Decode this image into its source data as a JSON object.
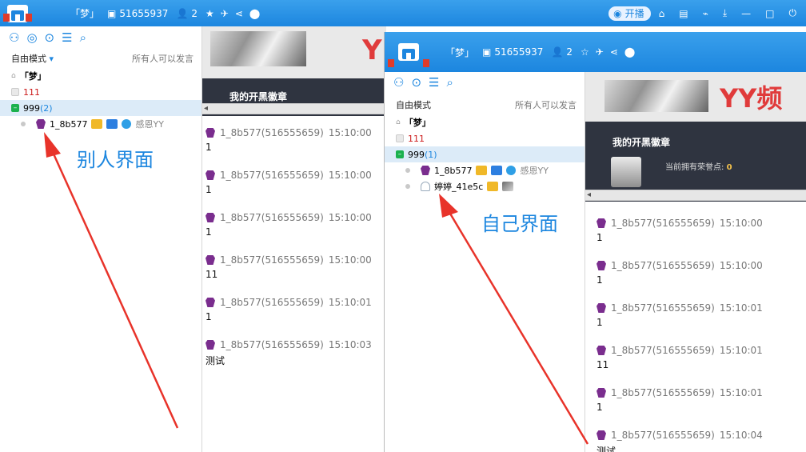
{
  "title_bar": {
    "channel_name": "「梦」",
    "channel_id": "51655937",
    "online_count": "2",
    "start_live_label": "开播"
  },
  "left_panel": {
    "mode_label": "自由模式",
    "speak_rule": "所有人可以发言",
    "tree": {
      "root": "「梦」",
      "sub1": "111",
      "group_name": "999",
      "group_count_a": "(2)",
      "member1": "1_8b577",
      "member1_extra": "感恩YY"
    }
  },
  "right_panel_a": {
    "badge_title": "我的开黑徽章"
  },
  "chat_a": {
    "messages": [
      {
        "sender": "1_8b577(516555659)",
        "time": "15:10:00",
        "text": "1"
      },
      {
        "sender": "1_8b577(516555659)",
        "time": "15:10:00",
        "text": "1"
      },
      {
        "sender": "1_8b577(516555659)",
        "time": "15:10:00",
        "text": "1"
      },
      {
        "sender": "1_8b577(516555659)",
        "time": "15:10:00",
        "text": "11"
      },
      {
        "sender": "1_8b577(516555659)",
        "time": "15:10:01",
        "text": "1"
      },
      {
        "sender": "1_8b577(516555659)",
        "time": "15:10:03",
        "text": "测试"
      }
    ]
  },
  "window_b": {
    "channel_name": "「梦」",
    "channel_id": "51655937",
    "online_count": "2",
    "mode_label": "自由模式",
    "speak_rule": "所有人可以发言",
    "tree": {
      "root": "「梦」",
      "sub1": "111",
      "group_name": "999",
      "group_count_b": "(1)",
      "member1": "1_8b577",
      "member1_extra": "感恩YY",
      "member2": "婷婷_41e5c"
    },
    "banner_text": "YY频道",
    "badge_title": "我的开黑徽章",
    "honor_label": "当前拥有荣誉点:",
    "honor_value": "0",
    "messages": [
      {
        "sender": "1_8b577(516555659)",
        "time": "15:10:00",
        "text": "1"
      },
      {
        "sender": "1_8b577(516555659)",
        "time": "15:10:00",
        "text": "1"
      },
      {
        "sender": "1_8b577(516555659)",
        "time": "15:10:01",
        "text": "1"
      },
      {
        "sender": "1_8b577(516555659)",
        "time": "15:10:01",
        "text": "11"
      },
      {
        "sender": "1_8b577(516555659)",
        "time": "15:10:01",
        "text": "1"
      },
      {
        "sender": "1_8b577(516555659)",
        "time": "15:10:04",
        "text": "测试"
      }
    ]
  },
  "annotations": {
    "others_view": "别人界面",
    "own_view": "自己界面",
    "arrow_color": "#e8332a"
  },
  "colors": {
    "title_blue": "#1c86df",
    "group_green": "#1bb14e",
    "dark_panel": "#2f3440"
  }
}
